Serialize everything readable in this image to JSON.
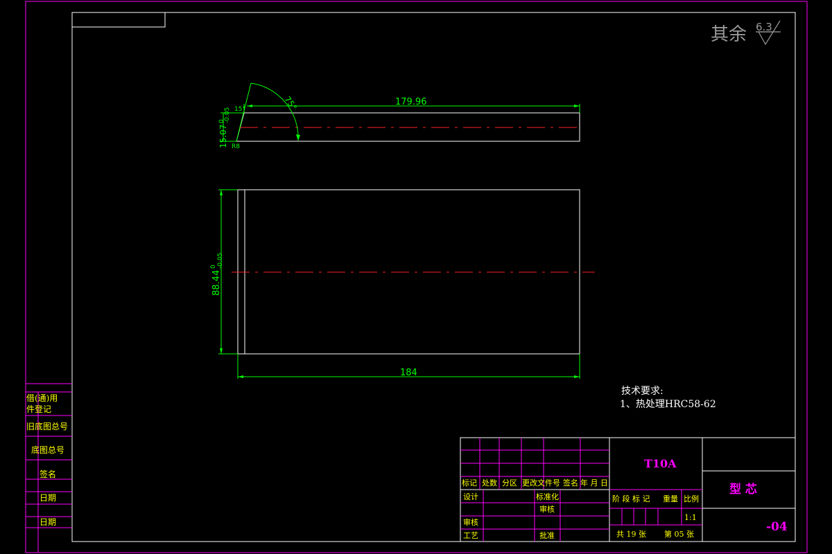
{
  "surface_finish": {
    "label": "其余",
    "value": "6.3"
  },
  "top_view": {
    "length_dim": "179.96",
    "height_dim": "15.07",
    "height_tol_upper": "0",
    "height_tol_lower": "-0.05",
    "angle_dim": "75°",
    "small_dim_a": "15°",
    "small_dim_b": "R8"
  },
  "front_view": {
    "height_dim": "88.44",
    "height_tol_upper": "0",
    "height_tol_lower": "-0.05",
    "width_dim": "184"
  },
  "tech_requirements": {
    "title": "技术要求:",
    "item1": "1、热处理HRC58-62"
  },
  "left_strip": {
    "borrow_reg_1": "借(通)用",
    "borrow_reg_2": "件登记",
    "old_drawing_no": "旧底图总号",
    "base_drawing_no": "底图总号",
    "signature": "签名",
    "date_1": "日期",
    "date_2": "日期"
  },
  "title_block": {
    "material": "T10A",
    "part_name": "型 芯",
    "drawing_no": "-04",
    "rev_header": [
      "标记",
      "处数",
      "分区",
      "更改文件号",
      "签名",
      "年 月 日"
    ],
    "design": "设计",
    "standardization": "标准化",
    "review_1": "审核",
    "review_2": "审核",
    "process": "工艺",
    "approve": "批准",
    "stage_header": [
      "阶 段 标 记",
      "重量",
      "比例"
    ],
    "scale": "1:1",
    "sheets_total": "共 19 张",
    "sheet_no": "第 05 张"
  }
}
